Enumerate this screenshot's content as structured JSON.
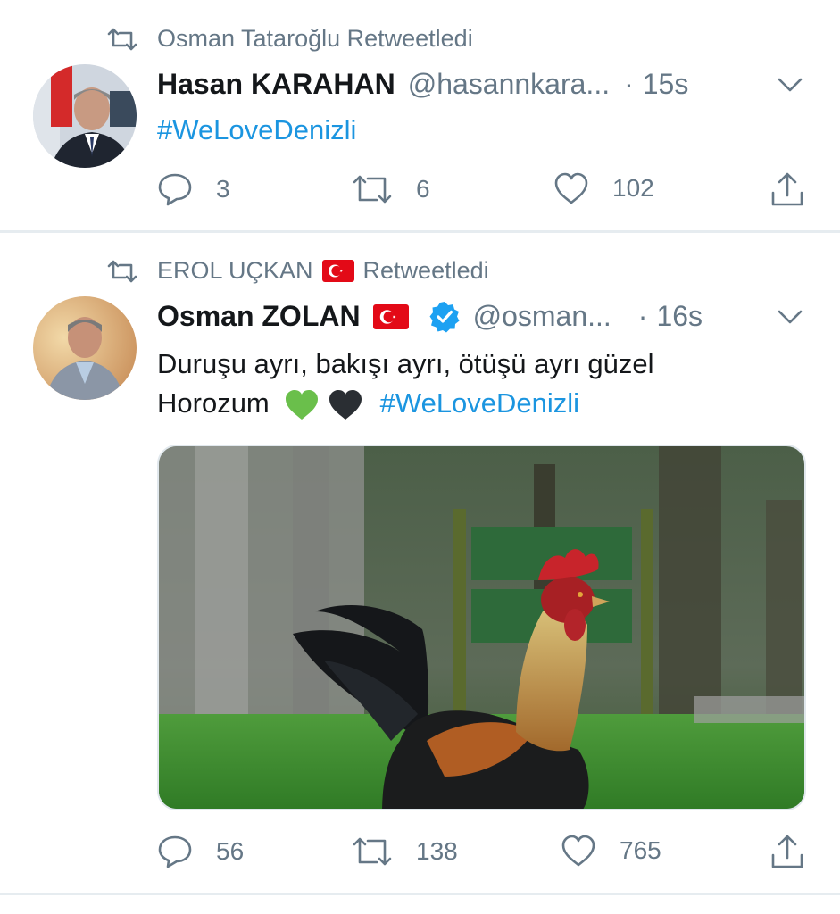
{
  "tweets": [
    {
      "retweeted_by": "Osman Tataroğlu Retweetledi",
      "retweeted_by_flag": false,
      "author_name": "Hasan KARAHAN",
      "author_flag": false,
      "verified": false,
      "handle": "@hasannkara...",
      "time": "15s",
      "text": "",
      "hashtag": "#WeLoveDenizli",
      "has_media": false,
      "replies": "3",
      "retweets": "6",
      "likes": "102"
    },
    {
      "retweeted_by_name": "EROL UÇKAN",
      "retweeted_by_flag": true,
      "retweeted_by_suffix": "Retweetledi",
      "author_name": "Osman ZOLAN",
      "author_flag": true,
      "verified": true,
      "handle": "@osman...",
      "time": "16s",
      "text_line1": "Duruşu ayrı, bakışı ayrı, ötüşü ayrı güzel",
      "text_line2": "Horozum",
      "hearts": [
        "green-heart-emoji",
        "black-heart-emoji"
      ],
      "hashtag": "#WeLoveDenizli",
      "has_media": true,
      "media_description_icon": "rooster-photo",
      "replies": "56",
      "retweets": "138",
      "likes": "765"
    }
  ],
  "separator": "·",
  "colors": {
    "link": "#1b95e0",
    "secondary": "#657786",
    "verified": "#1da1f2",
    "flag": "#e30a17",
    "divider": "#e6ecf0"
  },
  "icons": [
    "retweet-icon",
    "reply-icon",
    "like-icon",
    "share-icon",
    "chevron-down-icon",
    "verified-badge-icon",
    "turkish-flag-icon"
  ]
}
